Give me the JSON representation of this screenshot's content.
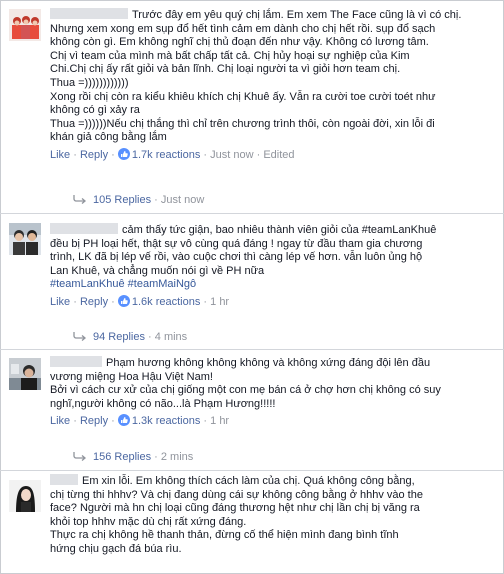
{
  "colors": {
    "link": "#365899",
    "meta": "#90949c",
    "like_blue": "#5890ff",
    "name_redacted": "#dfe1e5"
  },
  "comments": [
    {
      "lines": [
        "Trước đây em yêu quý chị lắm. Em xem The Face cũng là vì có chị.",
        "Nhưng xem xong em sụp đổ hết tình cảm em dành cho chị hết rồi. sụp đổ sạch",
        "không còn gì. Em không nghĩ chị thủ đoạn đến như vậy. Không có lương tâm.",
        "Chị vì team của mình mà bất chấp tất cả. Chị hủy hoại sự nghiệp của Kim",
        "Chi.Chị chị ấy rất giỏi và bản lĩnh. Chị loại người ta vì giỏi hơn team chị.",
        "Thua =))))))))))))",
        "Xong rồi chị còn ra kiểu khiêu khích chị Khuê ấy. Vẫn ra cười toe cười toét như",
        "không có gì xảy ra",
        "Thua =))))))Nếu chị thắng thì chỉ trên chương trình thôi, còn ngoài đời, xin lỗi đi",
        "khán giả công bằng lắm"
      ],
      "like": "Like",
      "reply": "Reply",
      "reactions": "1.7k reactions",
      "time": "Just now",
      "edited": "Edited",
      "replies_label": "105 Replies",
      "replies_time": "Just now"
    },
    {
      "lines": [
        "cảm thấy tức giận, bao nhiêu thành viên giỏi của #teamLanKhuê",
        "đều bị PH loại hết, thật sự vô cùng quá đáng ! ngay từ đầu tham gia chương",
        "trình, LK đã bị lép vế rồi, vào cuộc chơi thì càng lép vế hơn. vẫn luôn ủng hộ",
        "Lan Khuê, và chẳng muốn nói gì về PH nữa",
        "#teamLanKhuê #teamMaiNgô"
      ],
      "like": "Like",
      "reply": "Reply",
      "reactions": "1.6k reactions",
      "time": "1 hr",
      "replies_label": "94 Replies",
      "replies_time": "4 mins"
    },
    {
      "lines": [
        "Phạm hương không không không và không xứng đáng đội lên đầu",
        "vương miệng Hoa Hậu Việt Nam!",
        "Bởi vì cách cư xử của chị giống một con mẹ bán cá ở chợ hơn chị không có suy",
        "nghĩ,người không có não...là Phạm Hương!!!!!"
      ],
      "like": "Like",
      "reply": "Reply",
      "reactions": "1.3k reactions",
      "time": "1 hr",
      "replies_label": "156 Replies",
      "replies_time": "2 mins"
    },
    {
      "lines": [
        "Em xin lỗi. Em không thích cách làm của chị. Quá không công bằng,",
        "chị từng thi hhhv? Và chị đang dùng cái sự không công bằng ở hhhv vào the",
        "face? Người mà hn chị loại cũng đáng thương hệt như chị lần chị bị văng ra",
        "khỏi top hhhv mặc dù chị rất xứng đáng.",
        "Thực ra chị không hề thanh thản, đừng cố thể hiện mình đang bình tĩnh",
        "hứng chịu gạch đá búa rìu."
      ]
    }
  ]
}
